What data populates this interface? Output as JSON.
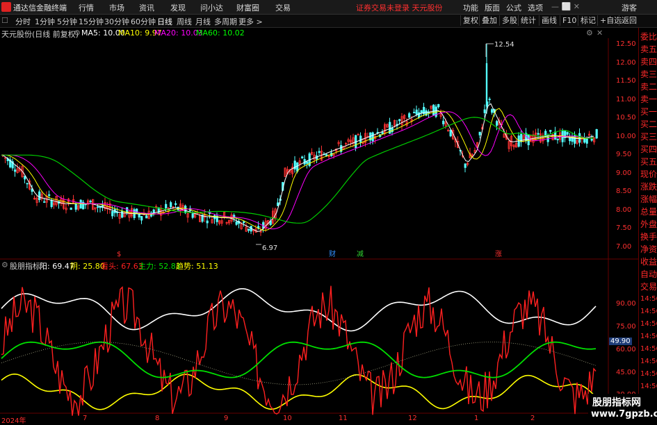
{
  "app": {
    "title": "通达信金融终端",
    "menu": [
      "行情",
      "市场",
      "资讯",
      "发现",
      "问小达",
      "财富圈",
      "交易"
    ],
    "status_msg": "证券交易未登录  天元股份",
    "right_menu": [
      "功能",
      "版面",
      "公式",
      "选项",
      "游客"
    ]
  },
  "toolbar": {
    "timeframes": [
      "分时",
      "1分钟",
      "5分钟",
      "15分钟",
      "30分钟",
      "60分钟",
      "日线",
      "周线",
      "月线",
      "多周期",
      "更多 >"
    ],
    "active_timeframe": "日线",
    "right_buttons": [
      "复权",
      "叠加",
      "多股",
      "统计",
      "画线",
      "F10",
      "标记",
      "+自选",
      "返回"
    ]
  },
  "main_chart": {
    "stock_label": "天元股份(日线 前复权)",
    "ma": [
      {
        "label": "MA5: 10.00",
        "color": "#ffffff"
      },
      {
        "label": "MA10: 9.97",
        "color": "#ffff00"
      },
      {
        "label": "MA20: 10.03",
        "color": "#ff00ff"
      },
      {
        "label": "MA60: 10.02",
        "color": "#00ff00"
      }
    ],
    "y_ticks": [
      "12.50",
      "12.00",
      "11.50",
      "11.00",
      "10.50",
      "10.00",
      "9.50",
      "9.00",
      "8.50",
      "8.00",
      "7.50",
      "7.00"
    ],
    "high_mark": "12.54",
    "low_mark": "6.97",
    "event_marks": [
      {
        "text": "$",
        "color": "#ff3030"
      },
      {
        "text": "财",
        "color": "#3090ff"
      },
      {
        "text": "减",
        "color": "#30d030"
      },
      {
        "text": "涨",
        "color": "#ff3030"
      }
    ]
  },
  "indicator": {
    "name": "股朋指标",
    "values": [
      {
        "label": "阳: 69.47",
        "color": "#ffffff"
      },
      {
        "label": "阴: 25.80",
        "color": "#ffff00"
      },
      {
        "label": "看头: 67.63",
        "color": "#ff2020"
      },
      {
        "label": "主力: 52.83",
        "color": "#00e000"
      },
      {
        "label": "趋势: 51.13",
        "color": "#ffff00"
      }
    ],
    "y_ticks": [
      "90.00",
      "75.00",
      "60.00",
      "45.00",
      "30.00"
    ],
    "current_value": "49.90"
  },
  "dates": [
    "2024年",
    "7",
    "8",
    "9",
    "10",
    "11",
    "12",
    "1",
    "2"
  ],
  "sidebar": {
    "items": [
      "委比",
      "卖五",
      "卖四",
      "卖三",
      "卖二",
      "卖一",
      "买一",
      "买二",
      "买三",
      "买四",
      "买五",
      "现价",
      "涨跌",
      "涨幅",
      "总量",
      "外盘",
      "换手",
      "净资",
      "收益"
    ],
    "tabs": [
      "自动",
      "交易"
    ],
    "times": [
      "14:56",
      "14:56",
      "14:56",
      "14:56",
      "14:56",
      "14:56",
      "14:56",
      "14:56",
      "14:56",
      "14:56"
    ]
  },
  "watermark": {
    "line1": "股朋指标网",
    "line2": "www.7gpzb.com"
  }
}
